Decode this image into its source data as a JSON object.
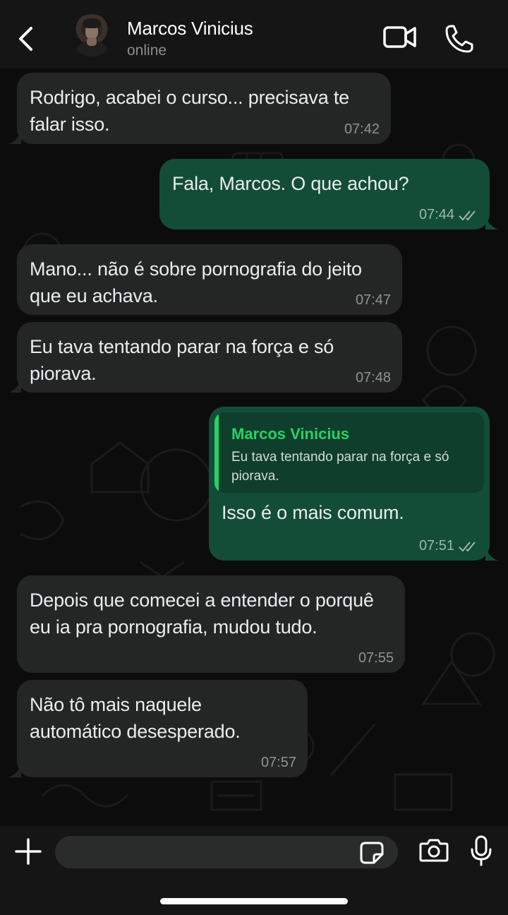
{
  "header": {
    "contact_name": "Marcos Vinicius",
    "contact_status": "online"
  },
  "messages": [
    {
      "direction": "in",
      "text": "Rodrigo, acabei o curso... precisava te falar isso.",
      "time": "07:42"
    },
    {
      "direction": "out",
      "text": "Fala, Marcos. O que achou?",
      "time": "07:44"
    },
    {
      "direction": "in",
      "text": "Mano... não é sobre pornografia do jeito que eu achava.",
      "time": "07:47"
    },
    {
      "direction": "in",
      "text": "Eu tava tentando parar na força e só piorava.",
      "time": "07:48"
    },
    {
      "direction": "out",
      "quoted_name": "Marcos Vinicius",
      "quoted_text": "Eu tava tentando parar na força e só piorava.",
      "text": "Isso é o mais comum.",
      "time": "07:51"
    },
    {
      "direction": "in",
      "text": "Depois que comecei a entender o porquê eu ia pra pornografia, mudou tudo.",
      "time": "07:55"
    },
    {
      "direction": "in",
      "text": "Não tô mais naquele automático desesperado.",
      "time": "07:57"
    }
  ],
  "composer": {
    "value": "",
    "placeholder": ""
  },
  "colors": {
    "incoming_bubble": "#242626",
    "outgoing_bubble": "#134d37",
    "accent_green": "#25d366",
    "header_bg": "#151515"
  },
  "icons": {
    "back": "chevron-left-icon",
    "video": "video-camera-icon",
    "call": "phone-icon",
    "read_receipt": "double-check-icon",
    "attach": "plus-icon",
    "sticker": "sticker-icon",
    "camera": "camera-icon",
    "mic": "microphone-icon"
  }
}
